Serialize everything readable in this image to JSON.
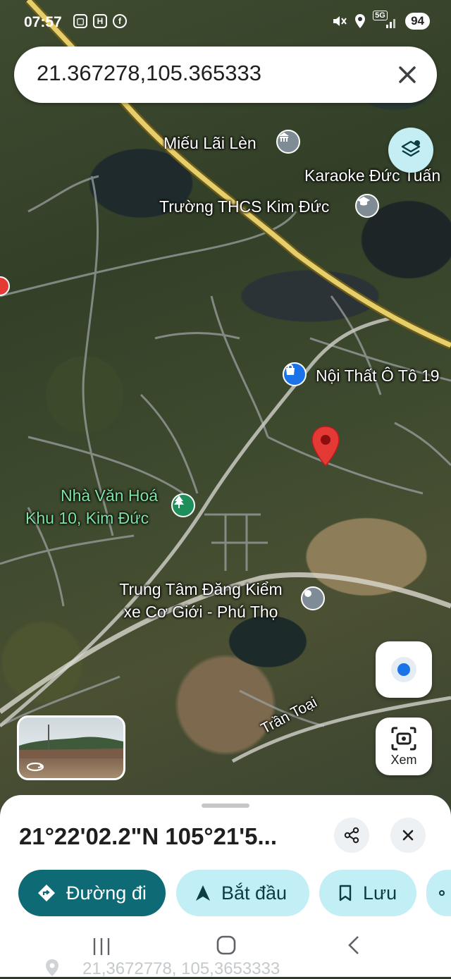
{
  "status_bar": {
    "time": "07:57",
    "network": "5G",
    "battery": "94"
  },
  "search": {
    "value": "21.367278,105.365333"
  },
  "map": {
    "places": [
      {
        "id": "mieu",
        "name": "Miếu Lãi Lèn"
      },
      {
        "id": "karaoke",
        "name": "Karaoke Đức Tuấn"
      },
      {
        "id": "thcs",
        "name": "Trường THCS Kim Đức"
      },
      {
        "id": "noithat",
        "name": "Nội Thất Ô Tô 19"
      },
      {
        "id": "nvh_line1",
        "name": "Nhà Văn Hoá"
      },
      {
        "id": "nvh_line2",
        "name": "Khu 10, Kim Đức"
      },
      {
        "id": "ttdk_line1",
        "name": "Trung Tâm Đăng Kiểm"
      },
      {
        "id": "ttdk_line2",
        "name": "xe Cơ Giới - Phú Thọ"
      },
      {
        "id": "road",
        "name": "Trần Toại"
      }
    ]
  },
  "buttons": {
    "lens_label": "Xem"
  },
  "sheet": {
    "coordinates": "21°22'02.2\"N 105°21'5...",
    "directions_label": "Đường đi",
    "start_label": "Bắt đầu",
    "save_label": "Lưu",
    "footer_coordinates": "21,3672778, 105,3653333"
  },
  "colors": {
    "primary": "#0e6a74",
    "secondary_pill": "#c2eef5",
    "pin": "#e53935"
  },
  "icons": [
    "nfc-icon",
    "h-icon",
    "facebook-icon",
    "mute-icon",
    "location-icon",
    "signal-icon",
    "close-icon",
    "layers-icon",
    "my-location-icon",
    "lens-icon",
    "share-icon",
    "navigation-icon",
    "bookmark-icon",
    "pin-icon"
  ]
}
